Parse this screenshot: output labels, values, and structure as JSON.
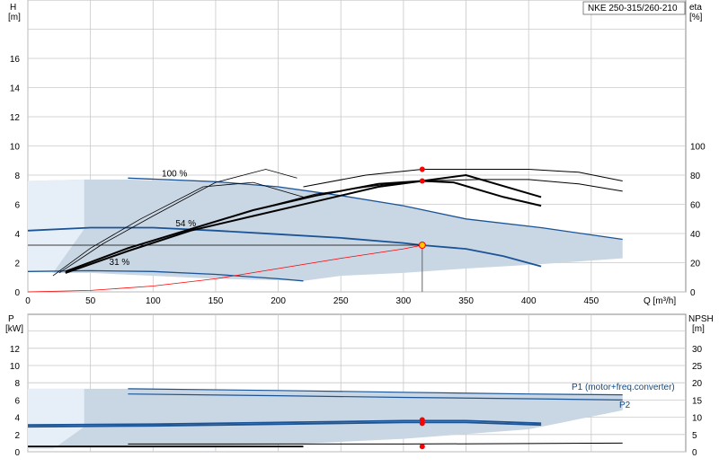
{
  "title": "NKE 250-315/260-210",
  "colors": {
    "band": "#c9d6e4",
    "band_light": "#e6eef7",
    "curve": "#1b5496",
    "duty": "#ff0000",
    "axis": "#000000",
    "grid": "#c8c8c8"
  },
  "chart_data": [
    {
      "type": "line",
      "name": "head",
      "x_label": "Q [m³/h]",
      "y_label_left": "H\n[m]",
      "y_label_right": "eta\n[%]",
      "xlim": [
        0,
        500
      ],
      "ylim": [
        0,
        20
      ],
      "ylim_right": [
        0,
        200
      ],
      "x_ticks": [
        "0",
        "50",
        "100",
        "150",
        "200",
        "250",
        "300",
        "350",
        "400",
        "450"
      ],
      "y_ticks_left": [
        "0",
        "2",
        "4",
        "6",
        "8",
        "10",
        "12",
        "14",
        "16"
      ],
      "y_ticks_right": [
        "0",
        "20",
        "40",
        "60",
        "80",
        "100"
      ],
      "annotations": [
        "100 %",
        "54 %",
        "31 %"
      ],
      "series": [
        {
          "role": "head_100",
          "x": [
            80,
            150,
            200,
            250,
            300,
            350,
            410,
            475
          ],
          "y": [
            7.8,
            7.55,
            7.2,
            6.6,
            5.9,
            5.0,
            4.4,
            3.6
          ]
        },
        {
          "role": "head_54",
          "x": [
            0,
            50,
            100,
            150,
            200,
            250,
            300,
            315,
            350,
            380,
            410
          ],
          "y": [
            4.2,
            4.4,
            4.4,
            4.2,
            3.95,
            3.7,
            3.35,
            3.2,
            2.95,
            2.45,
            1.75
          ]
        },
        {
          "role": "head_31",
          "x": [
            0,
            50,
            100,
            150,
            200,
            220
          ],
          "y": [
            1.4,
            1.45,
            1.4,
            1.2,
            0.9,
            0.75
          ]
        },
        {
          "role": "eta_max",
          "x": [
            30,
            80,
            130,
            180,
            230,
            280,
            315,
            340,
            380,
            410
          ],
          "y": [
            14,
            30,
            43,
            56,
            66,
            74,
            76,
            75,
            65,
            59
          ]
        },
        {
          "role": "eta_mid",
          "x": [
            30,
            80,
            130,
            180,
            230,
            280,
            315,
            350,
            410
          ],
          "y": [
            13,
            28,
            42,
            52,
            62,
            72,
            76,
            80,
            65
          ]
        },
        {
          "role": "eta_right",
          "x": [
            180,
            230,
            280,
            315,
            360,
            400,
            440,
            475
          ],
          "y": [
            56,
            67,
            73,
            76,
            77,
            77,
            74,
            69
          ]
        },
        {
          "role": "eta_right2",
          "x": [
            220,
            270,
            315,
            360,
            400,
            440,
            475
          ],
          "y": [
            72,
            80,
            84,
            84,
            84,
            82,
            76
          ]
        },
        {
          "role": "eta_left",
          "x": [
            20,
            50,
            90,
            140,
            180,
            220
          ],
          "y": [
            11,
            30,
            50,
            72,
            75,
            65
          ]
        },
        {
          "role": "eta_left2",
          "x": [
            25,
            60,
            100,
            150,
            190,
            215
          ],
          "y": [
            13,
            33,
            52,
            75,
            84,
            78
          ]
        },
        {
          "role": "system",
          "x": [
            0,
            50,
            100,
            150,
            200,
            250,
            300,
            315
          ],
          "y": [
            0,
            0.1,
            0.4,
            0.9,
            1.6,
            2.3,
            2.95,
            3.2
          ]
        }
      ],
      "duty_point": {
        "q": 315,
        "h": 3.2,
        "eta": [
          84,
          76
        ]
      }
    },
    {
      "type": "line",
      "name": "power",
      "y_label_left": "P\n[kW]",
      "y_label_right": "NPSH\n[m]",
      "xlim": [
        0,
        500
      ],
      "ylim": [
        0,
        13.6
      ],
      "ylim_right": [
        0,
        34
      ],
      "y_ticks_left": [
        "0",
        "2",
        "4",
        "6",
        "8",
        "10",
        "12"
      ],
      "y_ticks_right": [
        "0",
        "5",
        "10",
        "15",
        "20",
        "25",
        "30"
      ],
      "legend": [
        "P1 (motor+freq.converter)",
        "P2"
      ],
      "series": [
        {
          "role": "P1_100",
          "x": [
            80,
            200,
            300,
            400,
            475
          ],
          "y": [
            7.3,
            7.1,
            6.9,
            6.7,
            6.6
          ]
        },
        {
          "role": "P2_100",
          "x": [
            80,
            200,
            300,
            400,
            475
          ],
          "y": [
            6.7,
            6.5,
            6.3,
            6.15,
            6.0
          ]
        },
        {
          "role": "P1_54",
          "x": [
            0,
            100,
            200,
            300,
            350,
            410
          ],
          "y": [
            3.1,
            3.2,
            3.4,
            3.6,
            3.6,
            3.3
          ]
        },
        {
          "role": "P2_54",
          "x": [
            0,
            100,
            200,
            300,
            350,
            410
          ],
          "y": [
            2.9,
            3.0,
            3.2,
            3.4,
            3.4,
            3.1
          ]
        },
        {
          "role": "NPSH",
          "x": [
            80,
            200,
            300,
            400,
            475
          ],
          "y": [
            0.9,
            0.9,
            0.9,
            0.95,
            1.0
          ]
        },
        {
          "role": "P_31",
          "x": [
            0,
            100,
            200,
            220
          ],
          "y": [
            0.6,
            0.6,
            0.6,
            0.6
          ]
        }
      ],
      "duty_point": {
        "q": 315,
        "P": [
          3.7,
          3.3
        ],
        "npsh": 0.6
      }
    }
  ]
}
